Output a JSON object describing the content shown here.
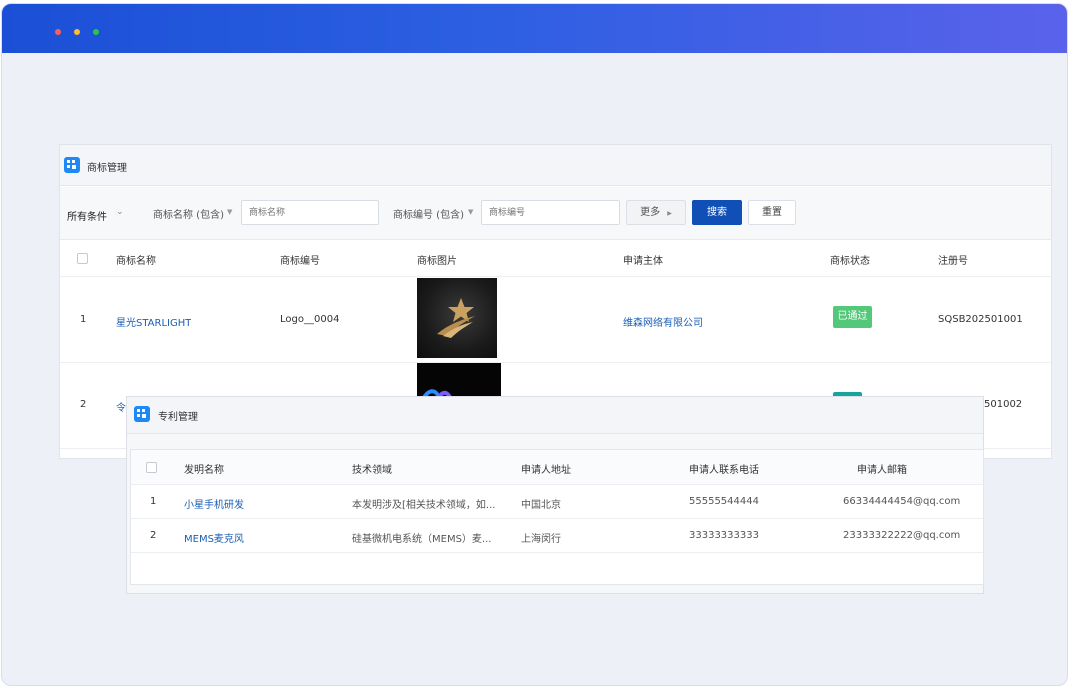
{
  "window": {
    "dots": [
      "close",
      "minimize",
      "maximize"
    ]
  },
  "trademark": {
    "title": "商标管理",
    "filter": {
      "all_conditions": "所有条件",
      "name_label": "商标名称 (包含)",
      "name_placeholder": "商标名称",
      "number_label": "商标编号 (包含)",
      "number_placeholder": "商标编号",
      "more": "更多",
      "search": "搜索",
      "reset": "重置"
    },
    "columns": [
      "商标名称",
      "商标编号",
      "商标图片",
      "申请主体",
      "商标状态",
      "注册号"
    ],
    "rows": [
      {
        "index": "1",
        "name": "星光STARLIGHT",
        "number": "Logo__0004",
        "image": "star-logo",
        "applicant": "维森网络有限公司",
        "status": "已通过",
        "reg_no": "SQSB202501001"
      },
      {
        "index": "2",
        "name": "令",
        "number": "",
        "image": "wave-logo",
        "applicant": "",
        "status": "",
        "reg_no": "501002"
      }
    ],
    "colors": {
      "status_approved": "#52c878",
      "status_teal": "#17a59b"
    }
  },
  "patent": {
    "title": "专利管理",
    "columns": [
      "发明名称",
      "技术领域",
      "申请人地址",
      "申请人联系电话",
      "申请人邮箱"
    ],
    "rows": [
      {
        "index": "1",
        "name": "小星手机研发",
        "field": "本发明涉及[相关技术领域，如...",
        "address": "中国北京",
        "phone": "55555544444",
        "email": "66334444454@qq.com"
      },
      {
        "index": "2",
        "name": "MEMS麦克风",
        "field": "硅基微机电系统（MEMS）麦...",
        "address": "上海闵行",
        "phone": "33333333333",
        "email": "23333322222@qq.com"
      }
    ]
  }
}
